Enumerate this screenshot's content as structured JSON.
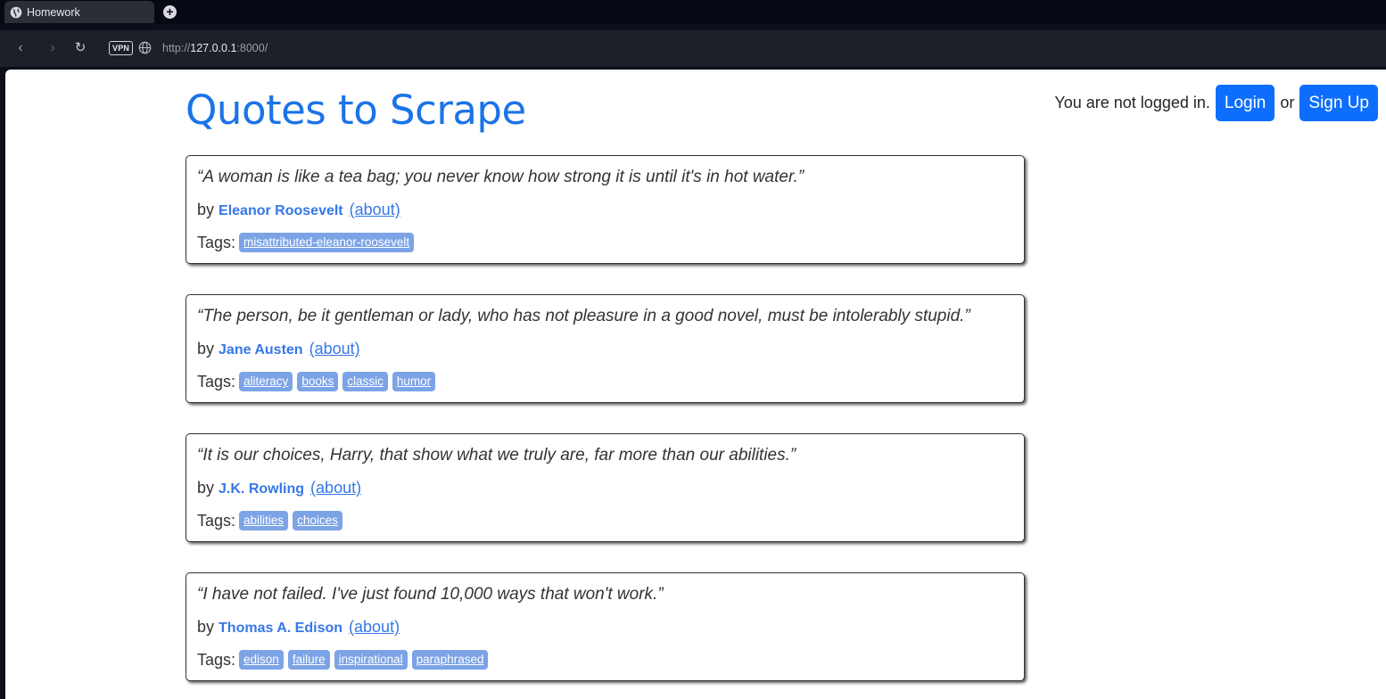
{
  "browser": {
    "tab_title": "Homework",
    "new_tab_symbol": "+",
    "back_symbol": "‹",
    "forward_symbol": "›",
    "reload_symbol": "↻",
    "vpn_label": "VPN",
    "url_host": "127.0.0.1",
    "url_prefix": "http://",
    "url_suffix": ":8000/"
  },
  "header": {
    "title": "Quotes to Scrape",
    "status_text": "You are not logged in.",
    "login_label": "Login",
    "or_text": "or",
    "signup_label": "Sign Up"
  },
  "labels": {
    "by": "by",
    "about": "(about)",
    "tags": "Tags:"
  },
  "quotes": [
    {
      "text": "“A woman is like a tea bag; you never know how strong it is until it's in hot water.”",
      "author": "Eleanor Roosevelt",
      "tags": [
        "misattributed-eleanor-roosevelt"
      ]
    },
    {
      "text": "“The person, be it gentleman or lady, who has not pleasure in a good novel, must be intolerably stupid.”",
      "author": "Jane Austen",
      "tags": [
        "aliteracy",
        "books",
        "classic",
        "humor"
      ]
    },
    {
      "text": "“It is our choices, Harry, that show what we truly are, far more than our abilities.”",
      "author": "J.K. Rowling",
      "tags": [
        "abilities",
        "choices"
      ]
    },
    {
      "text": "“I have not failed. I've just found 10,000 ways that won't work.”",
      "author": "Thomas A. Edison",
      "tags": [
        "edison",
        "failure",
        "inspirational",
        "paraphrased"
      ]
    }
  ],
  "colors": {
    "title_blue": "#1a73e8",
    "button_blue": "#0d6efd",
    "tag_bg": "#7ca3e6",
    "author_blue": "#3677e8"
  }
}
